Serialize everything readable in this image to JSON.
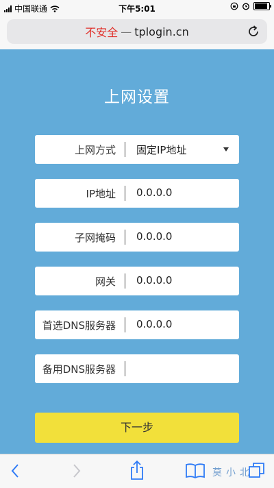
{
  "status_bar": {
    "carrier": "中国联通",
    "time": "下午5:01"
  },
  "browser": {
    "security_label": "不安全",
    "separator": "—",
    "domain": "tplogin.cn"
  },
  "page": {
    "title": "上网设置",
    "fields": [
      {
        "label": "上网方式",
        "value": "固定IP地址",
        "type": "select"
      },
      {
        "label": "IP地址",
        "value": "0.0.0.0",
        "type": "input"
      },
      {
        "label": "子网掩码",
        "value": "0.0.0.0",
        "type": "input"
      },
      {
        "label": "网关",
        "value": "0.0.0.0",
        "type": "input"
      },
      {
        "label": "首选DNS服务器",
        "value": "0.0.0.0",
        "type": "input"
      },
      {
        "label": "备用DNS服务器",
        "value": "",
        "type": "input"
      }
    ],
    "next_button": "下一步"
  },
  "toolbar": {
    "watermark": "莫小北"
  },
  "colors": {
    "page_background": "#62abd9",
    "button_yellow": "#f2e03a",
    "insecure_red": "#e0302a"
  },
  "icons": [
    "signal-icon",
    "wifi-icon",
    "lock-rotation-icon",
    "alarm-icon",
    "battery-icon",
    "reload-icon",
    "back-icon",
    "forward-icon",
    "share-icon",
    "bookmarks-icon",
    "tabs-icon"
  ]
}
